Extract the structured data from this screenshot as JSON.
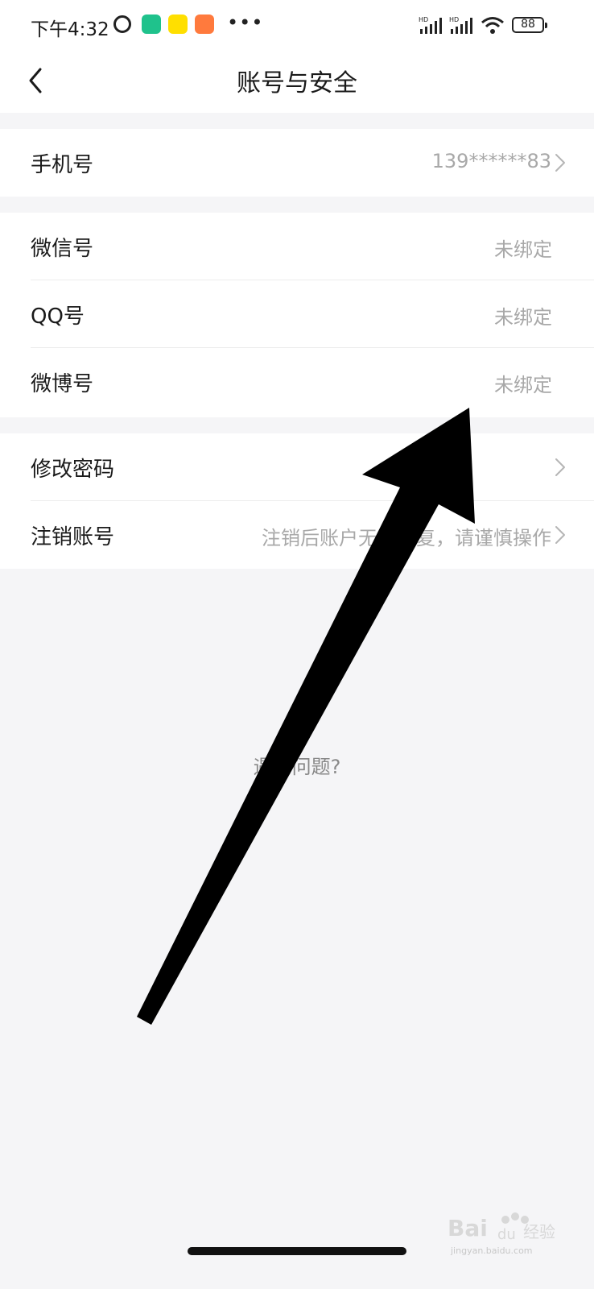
{
  "status_bar": {
    "time": "下午4:32",
    "battery": "88",
    "icons": [
      "alarm-icon",
      "app-icon",
      "app-icon",
      "app-icon",
      "more-dots-icon",
      "hd-signal-icon",
      "hd-signal-icon",
      "wifi-icon",
      "battery-icon"
    ]
  },
  "header": {
    "title": "账号与安全",
    "back_icon": "chevron-left-icon"
  },
  "sections": [
    {
      "rows": [
        {
          "label": "手机号",
          "value": "139******83",
          "chevron": true
        }
      ]
    },
    {
      "rows": [
        {
          "label": "微信号",
          "value": "未绑定",
          "chevron": false
        },
        {
          "label": "QQ号",
          "value": "未绑定",
          "chevron": false
        },
        {
          "label": "微博号",
          "value": "未绑定",
          "chevron": false
        }
      ]
    },
    {
      "rows": [
        {
          "label": "修改密码",
          "value": "",
          "chevron": true
        },
        {
          "label": "注销账号",
          "value": "注销后账户无法恢复，请谨慎操作",
          "chevron": true
        }
      ]
    }
  ],
  "help": {
    "text": "遇到问题?"
  },
  "watermark": {
    "text": "Bai du 经验",
    "sub": "jingyan.baidu.com"
  },
  "colors": {
    "background": "#f5f5f7",
    "card": "#ffffff",
    "secondary_text": "#a8a8a8",
    "annotation_arrow": "#000000"
  }
}
